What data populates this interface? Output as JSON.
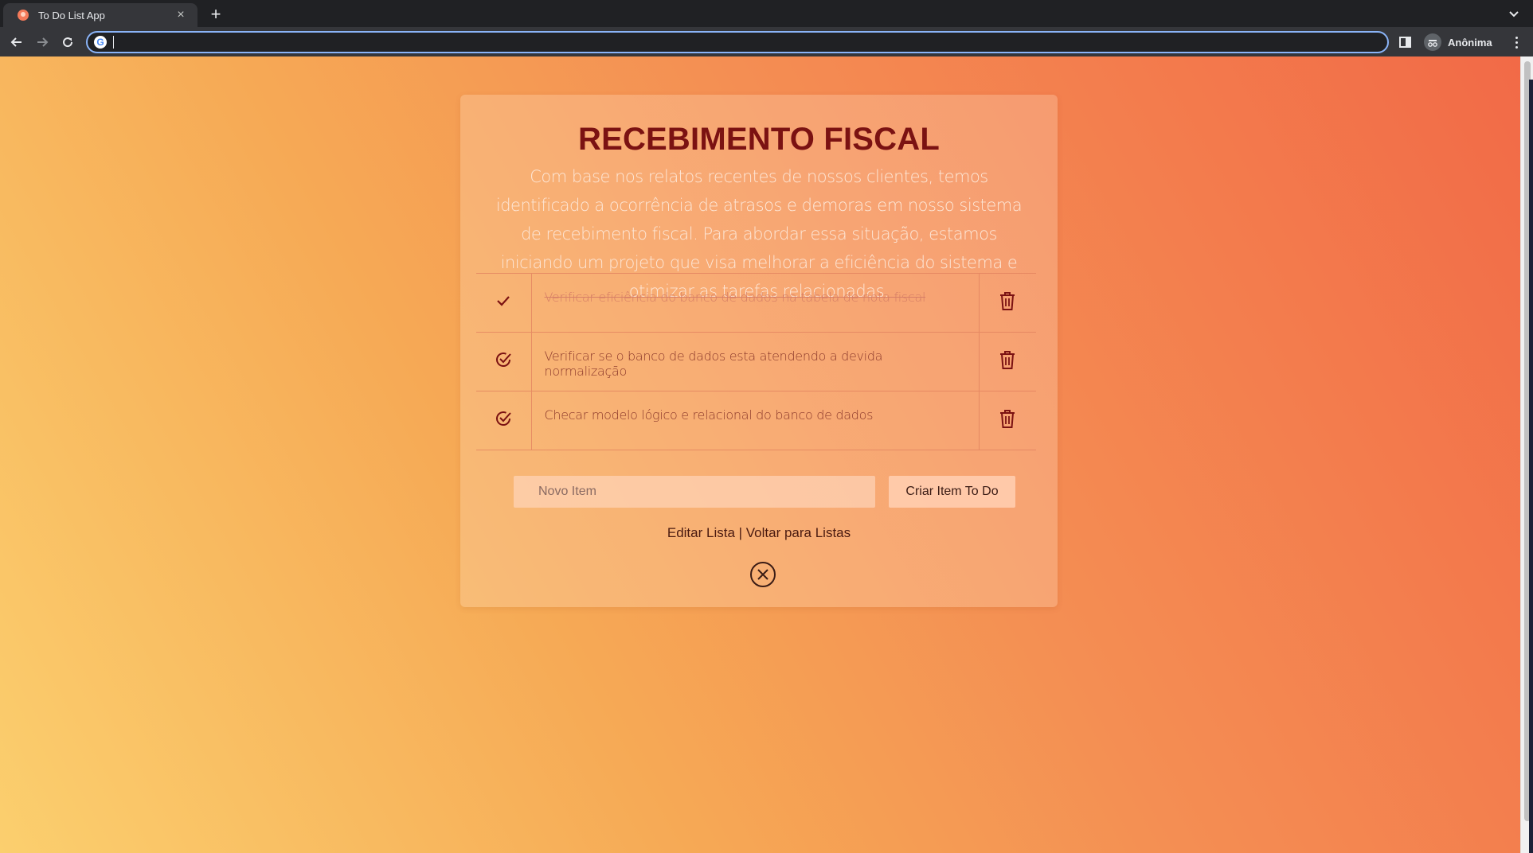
{
  "browser": {
    "tab_title": "To Do List App",
    "tab_close": "×",
    "new_tab": "+",
    "address_value": "",
    "profile_label": "Anônima"
  },
  "page": {
    "title": "RECEBIMENTO FISCAL",
    "description": "Com base nos relatos recentes de nossos clientes, temos identificado a ocorrência de atrasos e demoras em nosso sistema de recebimento fiscal. Para abordar essa situação, estamos iniciando um projeto que visa melhorar a eficiência do sistema e otimizar as tarefas relacionadas.",
    "items": [
      {
        "text": "Verificar eficiência do banco de dados na tabela de nota fiscal",
        "done": true
      },
      {
        "text": "Verificar se o banco de dados esta atendendo a devida normalização",
        "done": false
      },
      {
        "text": "Checar modelo lógico e relacional do banco de dados",
        "done": false
      }
    ],
    "new_item_placeholder": "Novo Item",
    "create_button": "Criar Item To Do",
    "edit_link": "Editar Lista",
    "link_separator": " | ",
    "back_link": "Voltar para Listas"
  },
  "colors": {
    "title": "#7b1212",
    "icon": "#7b1212",
    "gradient_start": "#fbcf6e",
    "gradient_end": "#f26a47"
  }
}
